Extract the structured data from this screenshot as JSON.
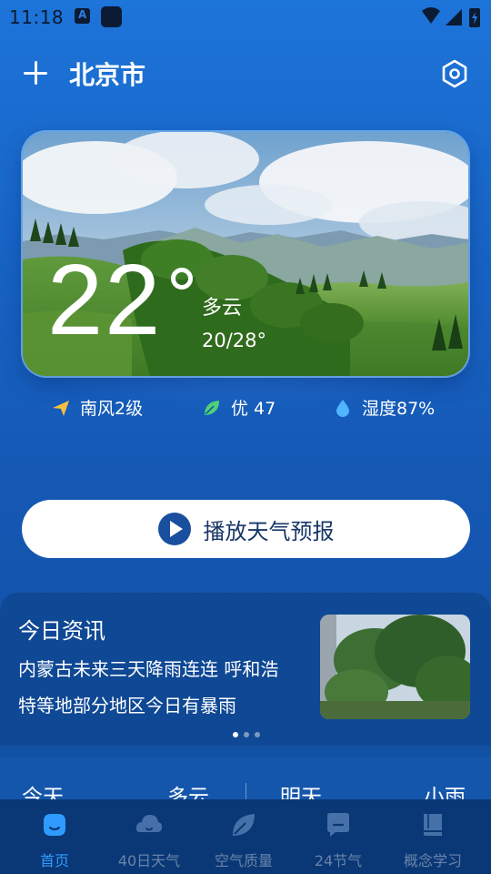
{
  "status_bar": {
    "time": "11:18"
  },
  "header": {
    "city": "北京市"
  },
  "weather": {
    "temperature": "22",
    "condition": "多云",
    "range": "20/28°"
  },
  "stats": {
    "wind": "南风2级",
    "air_quality": "优 47",
    "humidity": "湿度87%"
  },
  "play_button": {
    "label": "播放天气预报"
  },
  "news": {
    "title": "今日资讯",
    "headline_line1": "内蒙古未来三天降雨连连 呼和浩",
    "headline_line2": "特等地部分地区今日有暴雨",
    "page_count": 3,
    "active_page": 1
  },
  "forecast": {
    "today_label": "今天",
    "today_condition": "多云",
    "tomorrow_label": "明天",
    "tomorrow_condition": "小雨"
  },
  "bottom_nav": {
    "items": [
      {
        "label": "首页",
        "icon": "home-face-icon",
        "active": true
      },
      {
        "label": "40日天气",
        "icon": "cloud-icon",
        "active": false
      },
      {
        "label": "空气质量",
        "icon": "leaf-icon",
        "active": false
      },
      {
        "label": "24节气",
        "icon": "chat-icon",
        "active": false
      },
      {
        "label": "概念学习",
        "icon": "book-icon",
        "active": false
      }
    ]
  },
  "colors": {
    "background_top": "#1d74d9",
    "background_bottom": "#114c9c",
    "accent_active": "#2f9bff",
    "nav_bar": "#0a3775",
    "play_icon": "#1a4f9f"
  }
}
